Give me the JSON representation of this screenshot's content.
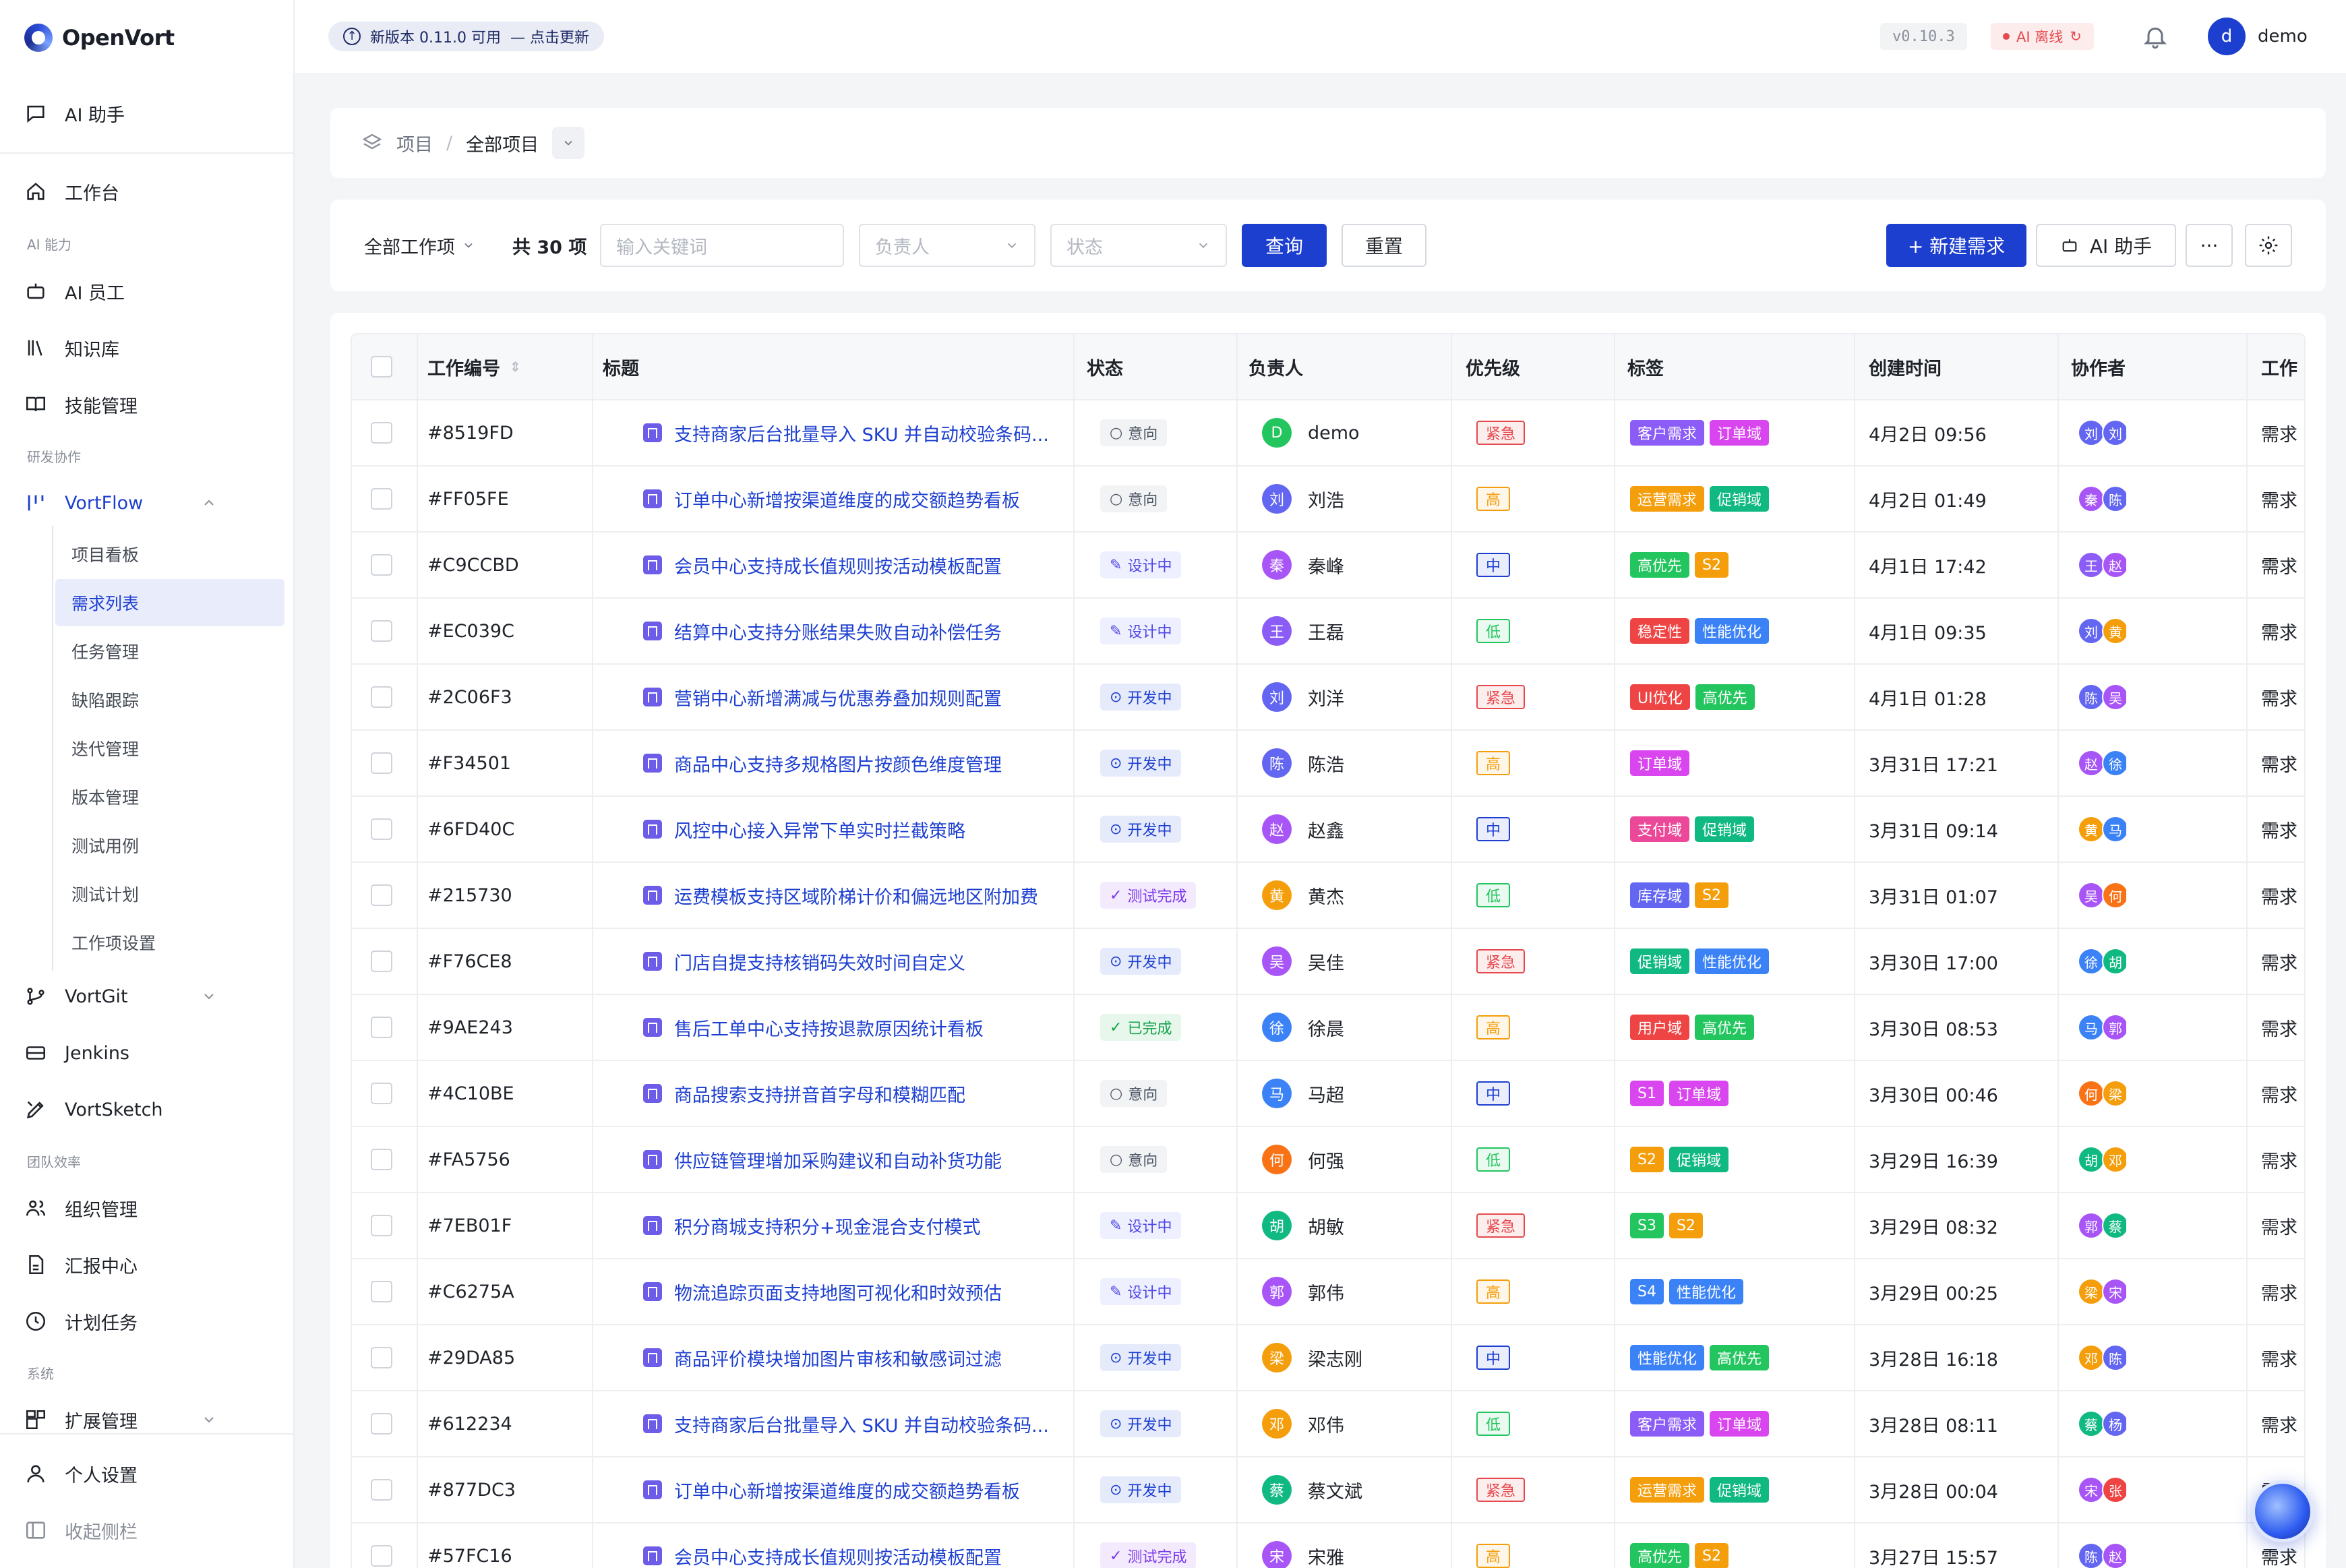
{
  "app": {
    "name": "OpenVort"
  },
  "sidebar": {
    "ai_assistant": "AI 助手",
    "workbench": "工作台",
    "sec_ai": "AI 能力",
    "ai_staff": "AI 员工",
    "knowledge": "知识库",
    "skills": "技能管理",
    "sec_dev": "研发协作",
    "vortflow": "VortFlow",
    "vortflow_items": [
      "项目看板",
      "需求列表",
      "任务管理",
      "缺陷跟踪",
      "迭代管理",
      "版本管理",
      "测试用例",
      "测试计划",
      "工作项设置"
    ],
    "vortgit": "VortGit",
    "jenkins": "Jenkins",
    "vortsketch": "VortSketch",
    "sec_team": "团队效率",
    "org": "组织管理",
    "report": "汇报中心",
    "plan": "计划任务",
    "sec_sys": "系统",
    "ext": "扩展管理",
    "personal": "个人设置",
    "collapse": "收起侧栏"
  },
  "topbar": {
    "update_text": "新版本 0.11.0 可用",
    "update_link": "— 点击更新",
    "version": "v0.10.3",
    "ai_status": "AI 离线",
    "user": "demo",
    "user_initial": "d"
  },
  "breadcrumb": {
    "root": "项目",
    "current": "全部项目"
  },
  "filters": {
    "type": "全部工作项",
    "count": "共 30 项",
    "keyword_placeholder": "输入关键词",
    "owner_placeholder": "负责人",
    "status_placeholder": "状态",
    "query": "查询",
    "reset": "重置",
    "new": "+ 新建需求",
    "ai": "AI 助手",
    "more": "···"
  },
  "table": {
    "headers": [
      "工作编号",
      "标题",
      "状态",
      "负责人",
      "优先级",
      "标签",
      "创建时间",
      "协作者",
      "工作"
    ],
    "rows": [
      {
        "id": "#8519FD",
        "title": "支持商家后台批量导入 SKU 并自动校验条码...",
        "status": "意向",
        "owner": "demo",
        "oi": "D",
        "prio": "紧急",
        "tags": [
          "客户需求",
          "订单域"
        ],
        "time": "4月2日 09:56",
        "collab": [
          "刘",
          "刘"
        ],
        "type": "需求"
      },
      {
        "id": "#FF05FE",
        "title": "订单中心新增按渠道维度的成交额趋势看板",
        "status": "意向",
        "owner": "刘浩",
        "oi": "刘",
        "prio": "高",
        "tags": [
          "运营需求",
          "促销域"
        ],
        "time": "4月2日 01:49",
        "collab": [
          "秦",
          "陈"
        ],
        "type": "需求"
      },
      {
        "id": "#C9CCBD",
        "title": "会员中心支持成长值规则按活动模板配置",
        "status": "设计中",
        "owner": "秦峰",
        "oi": "秦",
        "prio": "中",
        "tags": [
          "高优先",
          "S2"
        ],
        "time": "4月1日 17:42",
        "collab": [
          "王",
          "赵"
        ],
        "type": "需求"
      },
      {
        "id": "#EC039C",
        "title": "结算中心支持分账结果失败自动补偿任务",
        "status": "设计中",
        "owner": "王磊",
        "oi": "王",
        "prio": "低",
        "tags": [
          "稳定性",
          "性能优化"
        ],
        "time": "4月1日 09:35",
        "collab": [
          "刘",
          "黄"
        ],
        "type": "需求"
      },
      {
        "id": "#2C06F3",
        "title": "营销中心新增满减与优惠券叠加规则配置",
        "status": "开发中",
        "owner": "刘洋",
        "oi": "刘",
        "prio": "紧急",
        "tags": [
          "UI优化",
          "高优先"
        ],
        "time": "4月1日 01:28",
        "collab": [
          "陈",
          "吴"
        ],
        "type": "需求"
      },
      {
        "id": "#F34501",
        "title": "商品中心支持多规格图片按颜色维度管理",
        "status": "开发中",
        "owner": "陈浩",
        "oi": "陈",
        "prio": "高",
        "tags": [
          "订单域"
        ],
        "time": "3月31日 17:21",
        "collab": [
          "赵",
          "徐"
        ],
        "type": "需求"
      },
      {
        "id": "#6FD40C",
        "title": "风控中心接入异常下单实时拦截策略",
        "status": "开发中",
        "owner": "赵鑫",
        "oi": "赵",
        "prio": "中",
        "tags": [
          "支付域",
          "促销域"
        ],
        "time": "3月31日 09:14",
        "collab": [
          "黄",
          "马"
        ],
        "type": "需求"
      },
      {
        "id": "#215730",
        "title": "运费模板支持区域阶梯计价和偏远地区附加费",
        "status": "测试完成",
        "owner": "黄杰",
        "oi": "黄",
        "prio": "低",
        "tags": [
          "库存域",
          "S2"
        ],
        "time": "3月31日 01:07",
        "collab": [
          "吴",
          "何"
        ],
        "type": "需求"
      },
      {
        "id": "#F76CE8",
        "title": "门店自提支持核销码失效时间自定义",
        "status": "开发中",
        "owner": "吴佳",
        "oi": "吴",
        "prio": "紧急",
        "tags": [
          "促销域",
          "性能优化"
        ],
        "time": "3月30日 17:00",
        "collab": [
          "徐",
          "胡"
        ],
        "type": "需求"
      },
      {
        "id": "#9AE243",
        "title": "售后工单中心支持按退款原因统计看板",
        "status": "已完成",
        "owner": "徐晨",
        "oi": "徐",
        "prio": "高",
        "tags": [
          "用户域",
          "高优先"
        ],
        "time": "3月30日 08:53",
        "collab": [
          "马",
          "郭"
        ],
        "type": "需求"
      },
      {
        "id": "#4C10BE",
        "title": "商品搜索支持拼音首字母和模糊匹配",
        "status": "意向",
        "owner": "马超",
        "oi": "马",
        "prio": "中",
        "tags": [
          "S1",
          "订单域"
        ],
        "time": "3月30日 00:46",
        "collab": [
          "何",
          "梁"
        ],
        "type": "需求"
      },
      {
        "id": "#FA5756",
        "title": "供应链管理增加采购建议和自动补货功能",
        "status": "意向",
        "owner": "何强",
        "oi": "何",
        "prio": "低",
        "tags": [
          "S2",
          "促销域"
        ],
        "time": "3月29日 16:39",
        "collab": [
          "胡",
          "邓"
        ],
        "type": "需求"
      },
      {
        "id": "#7EB01F",
        "title": "积分商城支持积分+现金混合支付模式",
        "status": "设计中",
        "owner": "胡敏",
        "oi": "胡",
        "prio": "紧急",
        "tags": [
          "S3",
          "S2"
        ],
        "time": "3月29日 08:32",
        "collab": [
          "郭",
          "蔡"
        ],
        "type": "需求"
      },
      {
        "id": "#C6275A",
        "title": "物流追踪页面支持地图可视化和时效预估",
        "status": "设计中",
        "owner": "郭伟",
        "oi": "郭",
        "prio": "高",
        "tags": [
          "S4",
          "性能优化"
        ],
        "time": "3月29日 00:25",
        "collab": [
          "梁",
          "宋"
        ],
        "type": "需求"
      },
      {
        "id": "#29DA85",
        "title": "商品评价模块增加图片审核和敏感词过滤",
        "status": "开发中",
        "owner": "梁志刚",
        "oi": "梁",
        "prio": "中",
        "tags": [
          "性能优化",
          "高优先"
        ],
        "time": "3月28日 16:18",
        "collab": [
          "邓",
          "陈"
        ],
        "type": "需求"
      },
      {
        "id": "#612234",
        "title": "支持商家后台批量导入 SKU 并自动校验条码...",
        "status": "开发中",
        "owner": "邓伟",
        "oi": "邓",
        "prio": "低",
        "tags": [
          "客户需求",
          "订单域"
        ],
        "time": "3月28日 08:11",
        "collab": [
          "蔡",
          "杨"
        ],
        "type": "需求"
      },
      {
        "id": "#877DC3",
        "title": "订单中心新增按渠道维度的成交额趋势看板",
        "status": "开发中",
        "owner": "蔡文斌",
        "oi": "蔡",
        "prio": "紧急",
        "tags": [
          "运营需求",
          "促销域"
        ],
        "time": "3月28日 00:04",
        "collab": [
          "宋",
          "张"
        ],
        "type": "需求"
      },
      {
        "id": "#57FC16",
        "title": "会员中心支持成长值规则按活动模板配置",
        "status": "测试完成",
        "owner": "宋雅",
        "oi": "宋",
        "prio": "高",
        "tags": [
          "高优先",
          "S2"
        ],
        "time": "3月27日 15:57",
        "collab": [
          "陈",
          "赵"
        ],
        "type": "需求"
      }
    ]
  },
  "colors": {
    "primary": "#1d3fd0",
    "urgent": "#e5484d",
    "high": "#f59e0b",
    "mid": "#1d3fd0",
    "low": "#22c55e"
  }
}
